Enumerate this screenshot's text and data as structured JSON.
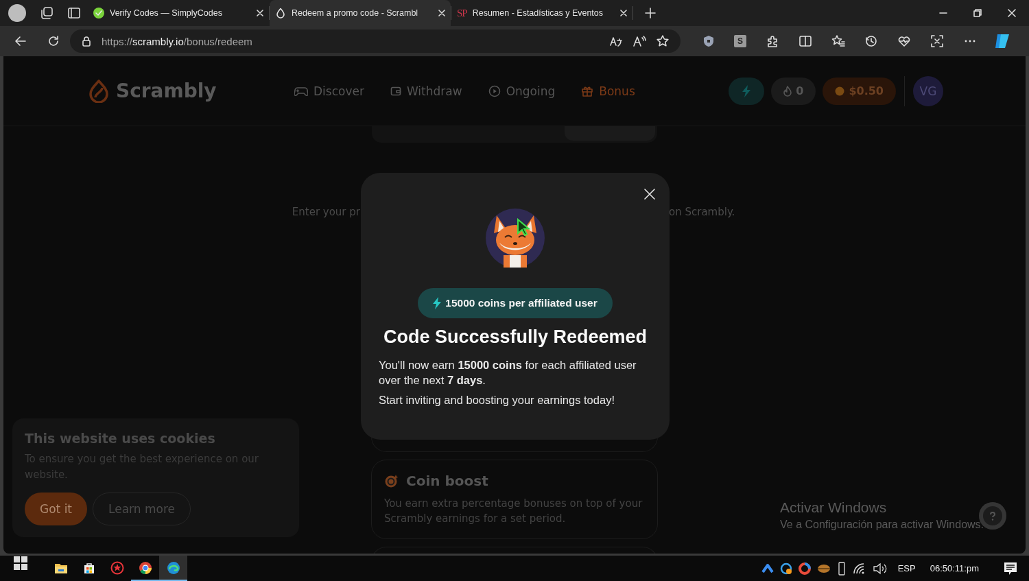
{
  "browser": {
    "tabs": [
      {
        "title": "Verify Codes — SimplyCodes",
        "selected": false
      },
      {
        "title": "Redeem a promo code - Scrambl",
        "selected": true
      },
      {
        "title": "Resumen - Estadísticas y Eventos",
        "favicon_text": "SP",
        "selected": false
      }
    ],
    "address": {
      "scheme": "https://",
      "host": "scrambly.io",
      "path": "/bonus/redeem"
    },
    "extension_label": "S"
  },
  "site": {
    "logo": "Scrambly",
    "nav": [
      {
        "label": "Discover",
        "selected": false
      },
      {
        "label": "Withdraw",
        "selected": false
      },
      {
        "label": "Ongoing",
        "selected": false
      },
      {
        "label": "Bonus",
        "selected": true
      }
    ],
    "streak": "0",
    "balance": "$0.50",
    "avatar": "VG"
  },
  "page": {
    "intro_left": "Enter your pr",
    "intro_right": "on Scrambly.",
    "cards": [
      {
        "title": "Coin boost",
        "description": "You earn extra percentage bonuses on top of your Scrambly earnings for a set period."
      }
    ]
  },
  "modal": {
    "badge": "15000 coins per affiliated user",
    "title": "Code Successfully Redeemed",
    "body": "You'll now earn **15000 coins** for each affiliated user over the next **7 days**.",
    "note": "Start inviting and boosting your earnings today!"
  },
  "cookie": {
    "title": "This website uses cookies",
    "text": "To ensure you get the best experience on our website.",
    "buttons": [
      {
        "label": "Got it",
        "kind": "primary"
      },
      {
        "label": "Learn more",
        "kind": "outline"
      }
    ]
  },
  "watermark": {
    "title": "Activar Windows",
    "subtitle": "Ve a Configuración para activar Windows."
  },
  "taskbar": {
    "apps": [
      {
        "kind": "explorer",
        "active": false,
        "running": false
      },
      {
        "kind": "store",
        "active": false,
        "running": false
      },
      {
        "kind": "red",
        "active": false,
        "running": false
      },
      {
        "kind": "chrome",
        "active": false,
        "running": true
      },
      {
        "kind": "edge",
        "active": true,
        "running": true
      }
    ],
    "language": "ESP",
    "time": "06:50:11:pm"
  }
}
